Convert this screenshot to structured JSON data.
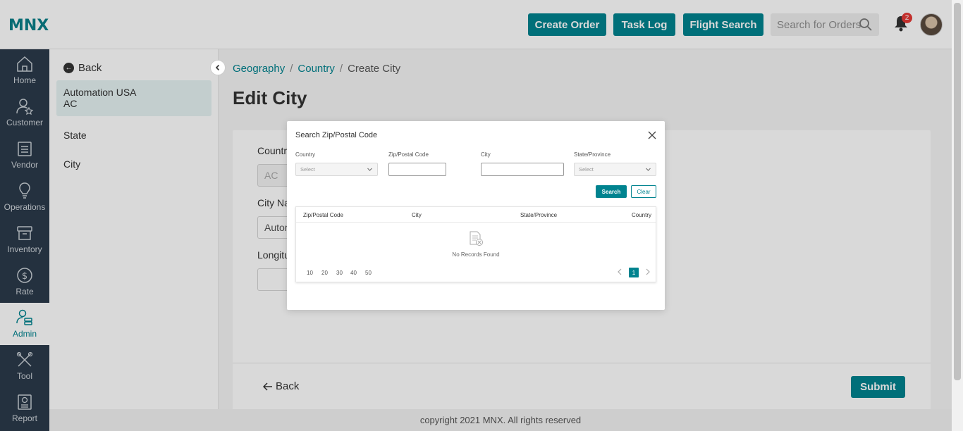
{
  "header": {
    "logo": "MNX",
    "buttons": [
      "Create Order",
      "Task Log",
      "Flight Search"
    ],
    "search_placeholder": "Search for Orders",
    "notification_count": "2"
  },
  "nav": [
    {
      "label": "Home",
      "icon": "home-icon"
    },
    {
      "label": "Customer",
      "icon": "customer-icon"
    },
    {
      "label": "Vendor",
      "icon": "vendor-icon"
    },
    {
      "label": "Operations",
      "icon": "bulb-icon"
    },
    {
      "label": "Inventory",
      "icon": "box-icon"
    },
    {
      "label": "Rate",
      "icon": "dollar-icon"
    },
    {
      "label": "Admin",
      "icon": "admin-icon",
      "active": true
    },
    {
      "label": "Tool",
      "icon": "tools-icon"
    },
    {
      "label": "Report",
      "icon": "report-icon"
    }
  ],
  "subnav": {
    "back": "Back",
    "active_line1": "Automation USA",
    "active_line2": "AC",
    "items": [
      "State",
      "City"
    ]
  },
  "breadcrumb": {
    "items": [
      "Geography",
      "Country"
    ],
    "current": "Create City"
  },
  "page_title": "Edit City",
  "form": {
    "country_label": "Countr",
    "country_value": "AC",
    "city_name_label": "City Na",
    "city_name_value": "Autom",
    "longitude_label": "Longitu"
  },
  "footer_actions": {
    "back": "Back",
    "submit": "Submit"
  },
  "copyright": "copyright 2021 MNX. All rights reserved",
  "modal": {
    "title": "Search Zip/Postal Code",
    "fields": {
      "country_label": "Country",
      "country_placeholder": "Select",
      "zip_label": "Zip/Postal Code",
      "city_label": "City",
      "state_label": "State/Province",
      "state_placeholder": "Select"
    },
    "search_button": "Search",
    "clear_button": "Clear",
    "columns": [
      "Zip/Postal Code",
      "City",
      "State/Province",
      "Country"
    ],
    "empty_text": "No Records Found",
    "page_sizes": [
      "10",
      "20",
      "30",
      "40",
      "50"
    ],
    "current_page": "1"
  },
  "colors": {
    "accent": "#00838f",
    "nav_bg": "#2b3a4a",
    "badge": "#e53935"
  }
}
